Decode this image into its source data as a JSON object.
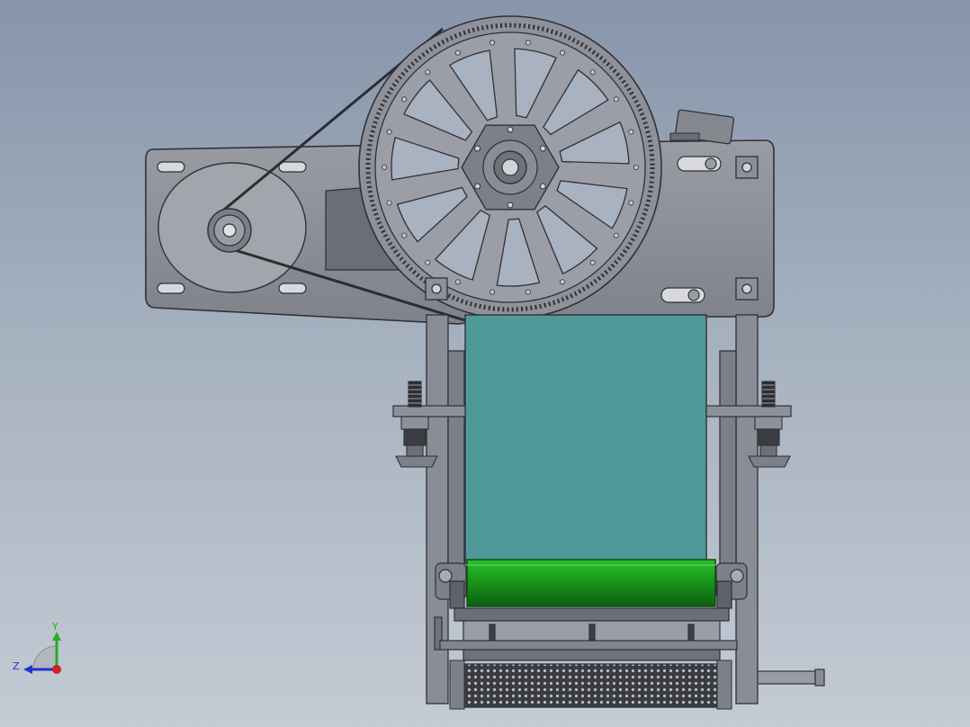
{
  "viewport": {
    "background_top": "#8795aa",
    "background_bottom": "#c3cbd4"
  },
  "colors": {
    "steel": "#8e9199",
    "steel_dark": "#5d6068",
    "outline": "#2f3136",
    "belt_teal": "#4f9a98",
    "roller_green": "#1fa01f",
    "roller_green_dark": "#0e6e12"
  },
  "drive": {
    "large_pulley_icon": "large-timing-pulley",
    "small_pulley_icon": "motor-pulley",
    "belt_icon": "timing-belt"
  },
  "triad": {
    "y_label": "Y",
    "z_label": "Z",
    "y_color": "#22b022",
    "z_color": "#2233cc",
    "x_color": "#cc2222"
  }
}
